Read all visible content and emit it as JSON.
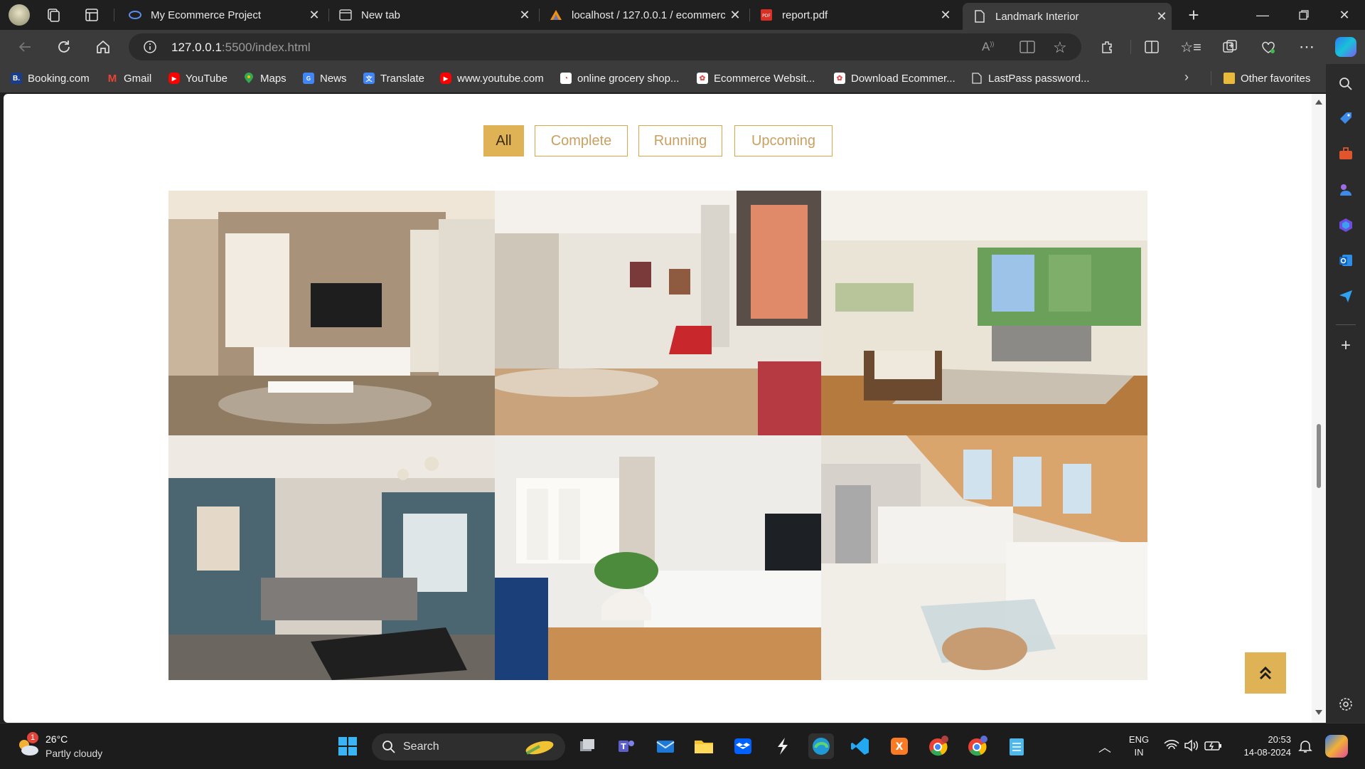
{
  "browser": {
    "tabs": [
      {
        "title": "My Ecommerce Project",
        "icon": "copilot-tab-icon"
      },
      {
        "title": "New tab",
        "icon": "newtab-icon"
      },
      {
        "title": "localhost / 127.0.0.1 / ecommerc",
        "icon": "phpmyadmin-icon"
      },
      {
        "title": "report.pdf",
        "icon": "pdf-icon"
      },
      {
        "title": "Landmark Interior",
        "icon": "page-icon",
        "active": true
      }
    ],
    "url_host": "127.0.0.1",
    "url_path": ":5500/index.html",
    "favorites": [
      {
        "label": "Booking.com",
        "icon": "booking-icon",
        "color": "#1a3e8c"
      },
      {
        "label": "Gmail",
        "icon": "gmail-icon",
        "color": "#ea4335"
      },
      {
        "label": "YouTube",
        "icon": "youtube-icon",
        "color": "#ff0000"
      },
      {
        "label": "Maps",
        "icon": "maps-icon",
        "color": "#34a853"
      },
      {
        "label": "News",
        "icon": "news-icon",
        "color": "#4285f4"
      },
      {
        "label": "Translate",
        "icon": "translate-icon",
        "color": "#4285f4"
      },
      {
        "label": "www.youtube.com",
        "icon": "youtube-icon",
        "color": "#ff0000"
      },
      {
        "label": "online grocery shop...",
        "icon": "grocery-icon",
        "color": "#ffffff"
      },
      {
        "label": "Ecommerce Websit...",
        "icon": "ecommerce-icon",
        "color": "#e04a4a"
      },
      {
        "label": "Download Ecommer...",
        "icon": "download-icon",
        "color": "#e04a4a"
      },
      {
        "label": "LastPass password...",
        "icon": "doc-icon",
        "color": "#cccccc"
      }
    ],
    "other_favorites": "Other favorites"
  },
  "page": {
    "filters": [
      {
        "label": "All",
        "active": true
      },
      {
        "label": "Complete"
      },
      {
        "label": "Running"
      },
      {
        "label": "Upcoming"
      }
    ],
    "gallery": [
      {
        "name": "living-room-tv-wall"
      },
      {
        "name": "apartment-red-chair"
      },
      {
        "name": "sunny-living-room"
      },
      {
        "name": "blue-wall-lounge"
      },
      {
        "name": "white-herringbone-room"
      },
      {
        "name": "attic-kitchen-lounge"
      }
    ],
    "back_to_top_icon": "double-chevron-up-icon"
  },
  "taskbar": {
    "weather_temp": "26°C",
    "weather_desc": "Partly cloudy",
    "weather_badge": "1",
    "search_label": "Search",
    "lang_top": "ENG",
    "lang_bottom": "IN",
    "time": "20:53",
    "date": "14-08-2024"
  },
  "colors": {
    "accent": "#e0b256",
    "accent_text": "#c8a062"
  }
}
